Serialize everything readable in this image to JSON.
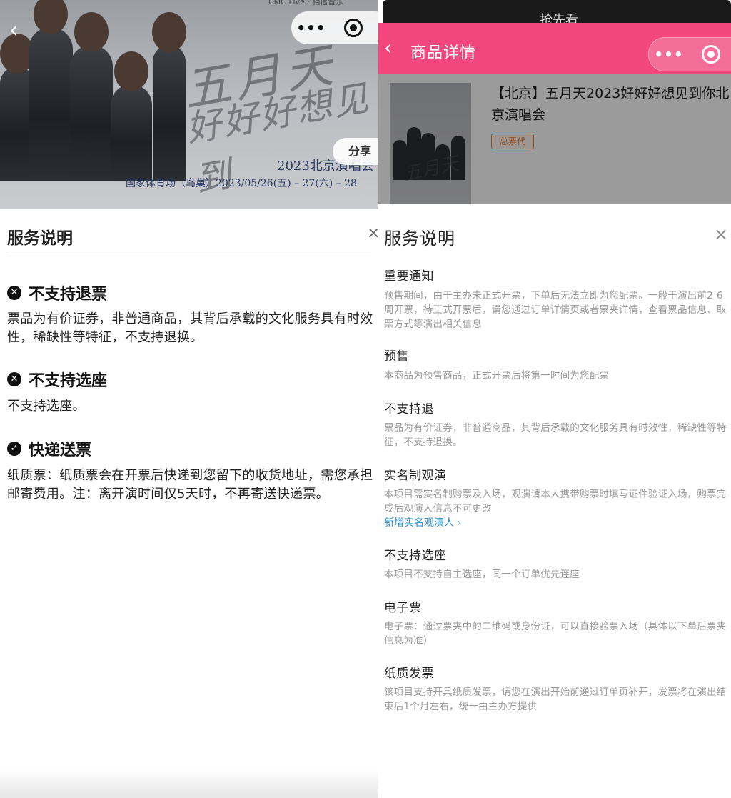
{
  "left": {
    "poster": {
      "cmc_text": "CMC Live · 相信音乐",
      "script_line1": "五月天",
      "script_line2": "好好好想见到",
      "year_city": "2023北京演唱会",
      "venue_dates": "国家体育场（鸟巢）2023/05/26(五) – 27(六) – 28"
    },
    "back_icon": "‹",
    "more_icon": "•••",
    "share_label": "分享",
    "sheet": {
      "title": "服务说明",
      "close_icon": "×",
      "sections": [
        {
          "icon": "✕",
          "title": "不支持退票",
          "text": "票品为有价证券，非普通商品，其背后承载的文化服务具有时效性，稀缺性等特征，不支持退换。"
        },
        {
          "icon": "✕",
          "title": "不支持选座",
          "text": "不支持选座。"
        },
        {
          "icon": "✓",
          "title": "快递送票",
          "text": "纸质票：纸质票会在开票后快递到您留下的收货地址，需您承担邮寄费用。注：离开演时间仅5天时，不再寄送快递票。"
        }
      ]
    }
  },
  "right": {
    "top_bar_text": "抢先看",
    "header": {
      "back_icon": "‹",
      "title": "商品详情",
      "more_icon": "•••"
    },
    "product": {
      "title": "【北京】五月天2023好好好想见到你北京演唱会",
      "badge": "总票代",
      "poster_script": "五月天"
    },
    "sheet": {
      "title": "服务说明",
      "close_icon": "×",
      "sections": [
        {
          "title": "重要通知",
          "text": "预售期间，由于主办未正式开票，下单后无法立即为您配票。一般于演出前2-6周开票，待正式开票后，请您通过订单详情页或者票夹详情，查看票品信息、取票方式等演出相关信息"
        },
        {
          "title": "预售",
          "text": "本商品为预售商品，正式开票后将第一时间为您配票"
        },
        {
          "title": "不支持退",
          "text": "票品为有价证券，非普通商品，其背后承载的文化服务具有时效性，稀缺性等特征，不支持退换。"
        },
        {
          "title": "实名制观演",
          "text": "本项目需实名制购票及入场，观演请本人携带购票时填写证件验证入场，购票完成后观演人信息不可更改",
          "link": "新增实名观演人 ›"
        },
        {
          "title": "不支持选座",
          "text": "本项目不支持自主选座，同一个订单优先连座"
        },
        {
          "title": "电子票",
          "text": "电子票：通过票夹中的二维码或身份证，可以直接验票入场（具体以下单后票夹信息为准）"
        },
        {
          "title": "纸质发票",
          "text": "该项目支持开具纸质发票，请您在演出开始前通过订单页补开，发票将在演出结束后1个月左右，统一由主办方提供"
        }
      ]
    }
  }
}
